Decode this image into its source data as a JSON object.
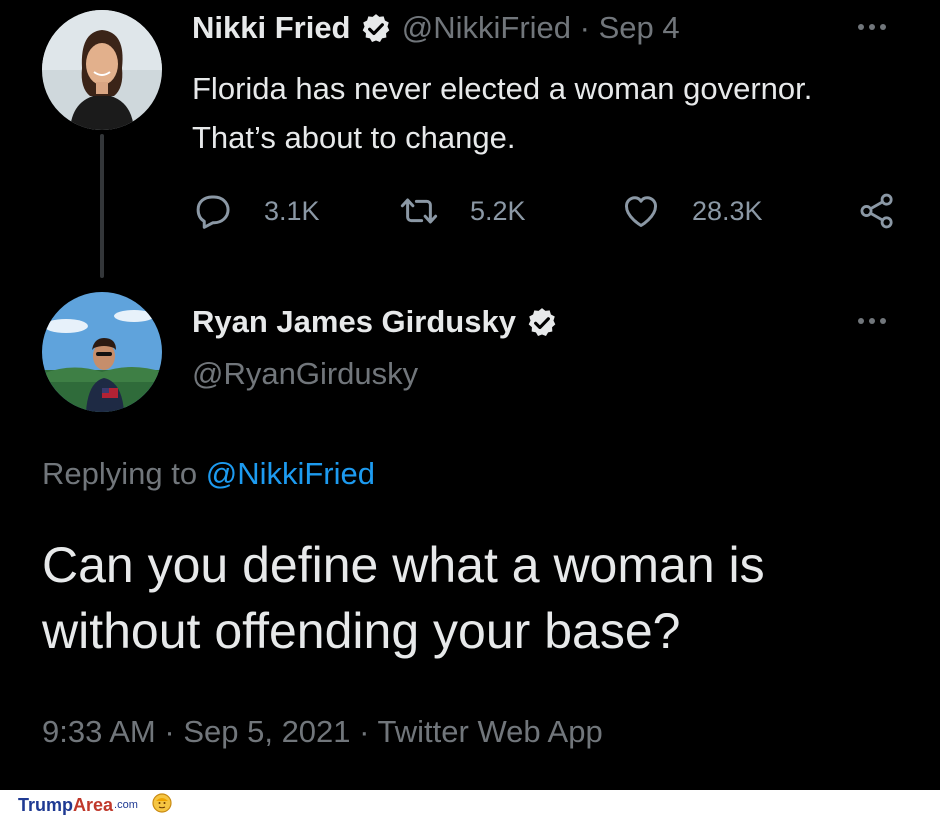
{
  "tweet_original": {
    "author_name": "Nikki Fried",
    "handle": "@NikkiFried",
    "separator": "·",
    "date": "Sep 4",
    "text": "Florida has never elected a woman governor. That’s about to change.",
    "stats": {
      "replies": "3.1K",
      "retweets": "5.2K",
      "likes": "28.3K"
    }
  },
  "tweet_reply": {
    "author_name": "Ryan James Girdusky",
    "handle": "@RyanGirdusky",
    "replying_prefix": "Replying to",
    "replying_to": "@NikkiFried",
    "text": "Can you define what a woman is without offending your base?",
    "time": "9:33 AM",
    "separator": "·",
    "date": "Sep 5, 2021",
    "source": "Twitter Web App"
  },
  "watermark": {
    "part1": "Trump",
    "part2": "Area",
    "part3": ".com"
  },
  "colors": {
    "background": "#000000",
    "text": "#e7e9ea",
    "muted": "#71767b",
    "link": "#1d9bf0"
  }
}
